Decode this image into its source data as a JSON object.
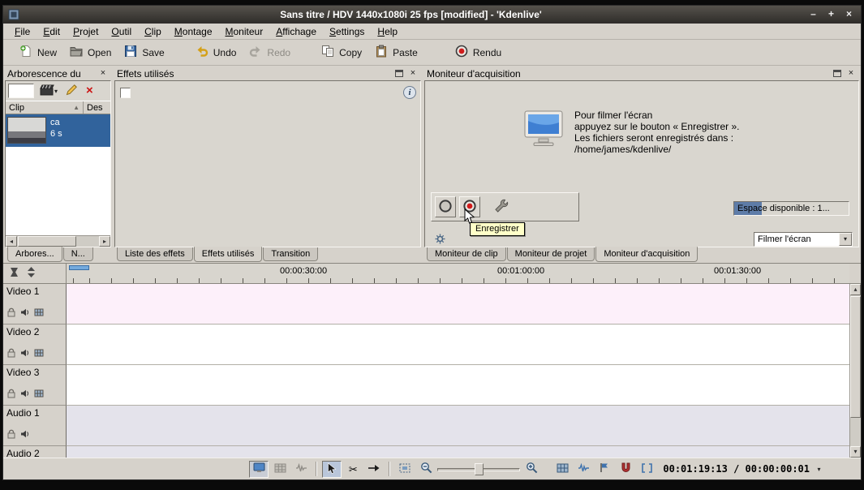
{
  "titlebar": {
    "title": "Sans titre / HDV 1440x1080i 25 fps [modified] - 'Kdenlive'"
  },
  "icons": {
    "minimize": "–",
    "maximize": "+",
    "close": "×",
    "arrow_up": "▴",
    "arrow_down": "▾",
    "arrow_left": "◂",
    "arrow_right": "▸",
    "dropdown": "▾",
    "sort_asc": "▲",
    "scissors": "✂",
    "delete_x": "×",
    "info": "i"
  },
  "menubar": {
    "items": [
      "File",
      "Edit",
      "Projet",
      "Outil",
      "Clip",
      "Montage",
      "Moniteur",
      "Affichage",
      "Settings",
      "Help"
    ]
  },
  "toolbar": {
    "new_label": "New",
    "open_label": "Open",
    "save_label": "Save",
    "undo_label": "Undo",
    "redo_label": "Redo",
    "copy_label": "Copy",
    "paste_label": "Paste",
    "render_label": "Rendu"
  },
  "project_tree": {
    "title": "Arborescence du",
    "filter_value": "",
    "column_clip": "Clip",
    "column_description": "Des",
    "clip_name": "ca",
    "clip_duration": "6 s",
    "tab_tree": "Arbores...",
    "tab_n": "N..."
  },
  "effects_panel": {
    "title": "Effets utilisés",
    "tab_effect_list": "Liste des effets",
    "tab_effect_stack": "Effets utilisés",
    "tab_transition": "Transition"
  },
  "capture_monitor": {
    "title": "Moniteur d'acquisition",
    "info_line1": "Pour filmer l'écran",
    "info_line2": "appuyez sur le bouton « Enregistrer ».",
    "info_line3": "Les fichiers seront enregistrés dans :",
    "info_line4": "/home/james/kdenlive/",
    "space_label": "Espace disponible : 1...",
    "tooltip": "Enregistrer",
    "source_value": "Filmer l'écran",
    "tab_clip": "Moniteur de clip",
    "tab_project": "Moniteur de projet",
    "tab_capture": "Moniteur d'acquisition"
  },
  "timeline": {
    "ruler_labels": [
      "00:00:30:00",
      "00:01:00:00",
      "00:01:30:00"
    ],
    "tracks": [
      {
        "label": "Video 1"
      },
      {
        "label": "Video 2"
      },
      {
        "label": "Video 3"
      },
      {
        "label": "Audio 1"
      },
      {
        "label": "Audio 2"
      }
    ]
  },
  "statusbar": {
    "timecode": "00:01:19:13 / 00:00:00:01"
  },
  "colors": {
    "selection_blue": "#31639c",
    "video1_track": "#fdf0fa",
    "audio_track": "#e4e3eb",
    "tooltip_bg": "#ffffc8",
    "record_red": "#d11a1a",
    "chrome": "#d6d2cb"
  }
}
